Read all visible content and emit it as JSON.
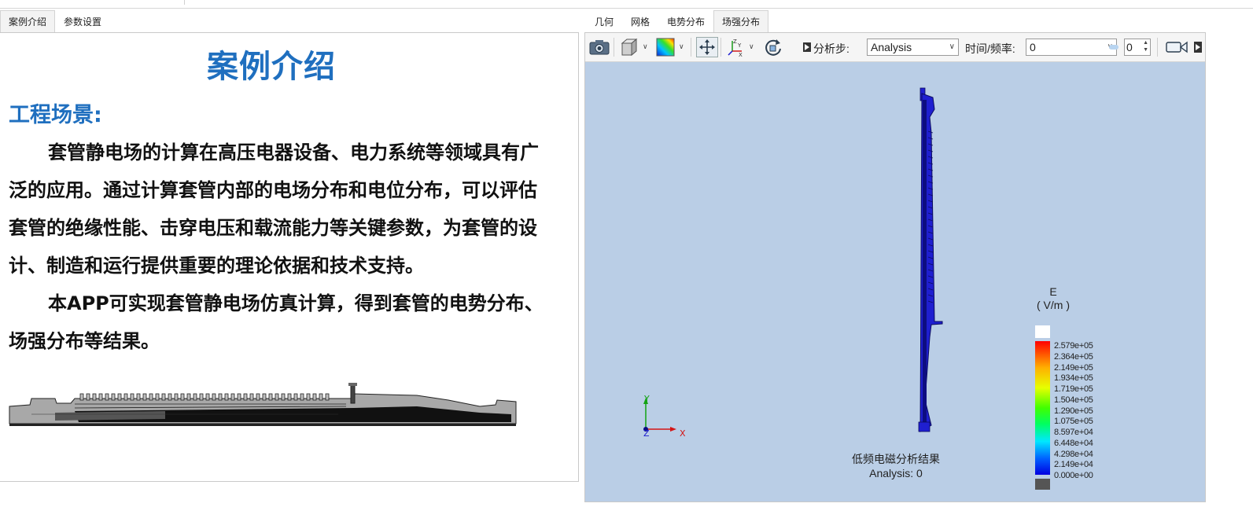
{
  "left_tabs": [
    {
      "label": "案例介绍",
      "active": true
    },
    {
      "label": "参数设置",
      "active": false
    }
  ],
  "intro": {
    "title": "案例介绍",
    "section_title": "工程场景:",
    "paragraph1": "套管静电场的计算在高压电器设备、电力系统等领域具有广泛的应用。通过计算套管内部的电场分布和电位分布，可以评估套管的绝缘性能、击穿电压和载流能力等关键参数，为套管的设计、制造和运行提供重要的理论依据和技术支持。",
    "paragraph2": "本APP可实现套管静电场仿真计算，得到套管的电势分布、场强分布等结果。"
  },
  "right_tabs": [
    {
      "label": "几何",
      "active": false
    },
    {
      "label": "网格",
      "active": false
    },
    {
      "label": "电势分布",
      "active": false
    },
    {
      "label": "场强分布",
      "active": true
    }
  ],
  "toolbar": {
    "analysis_step_label": "分析步:",
    "analysis_step_value": "Analysis",
    "time_freq_label": "时间/频率:",
    "time_freq_value": "0",
    "frame_value": "0"
  },
  "viewport": {
    "background": "#bacee6",
    "axis_labels": {
      "x": "X",
      "y": "Y",
      "z": "Z"
    },
    "caption_line1": "低频电磁分析结果",
    "caption_line2": "Analysis: 0",
    "legend": {
      "title": "E",
      "unit": "( V/m )",
      "labels": [
        "2.579e+05",
        "2.364e+05",
        "2.149e+05",
        "1.934e+05",
        "1.719e+05",
        "1.504e+05",
        "1.290e+05",
        "1.075e+05",
        "8.597e+04",
        "6.448e+04",
        "4.298e+04",
        "2.149e+04",
        "0.000e+00"
      ]
    }
  },
  "colors": {
    "accent_blue": "#1f6fbf",
    "model_blue": "#1f1fd0"
  }
}
